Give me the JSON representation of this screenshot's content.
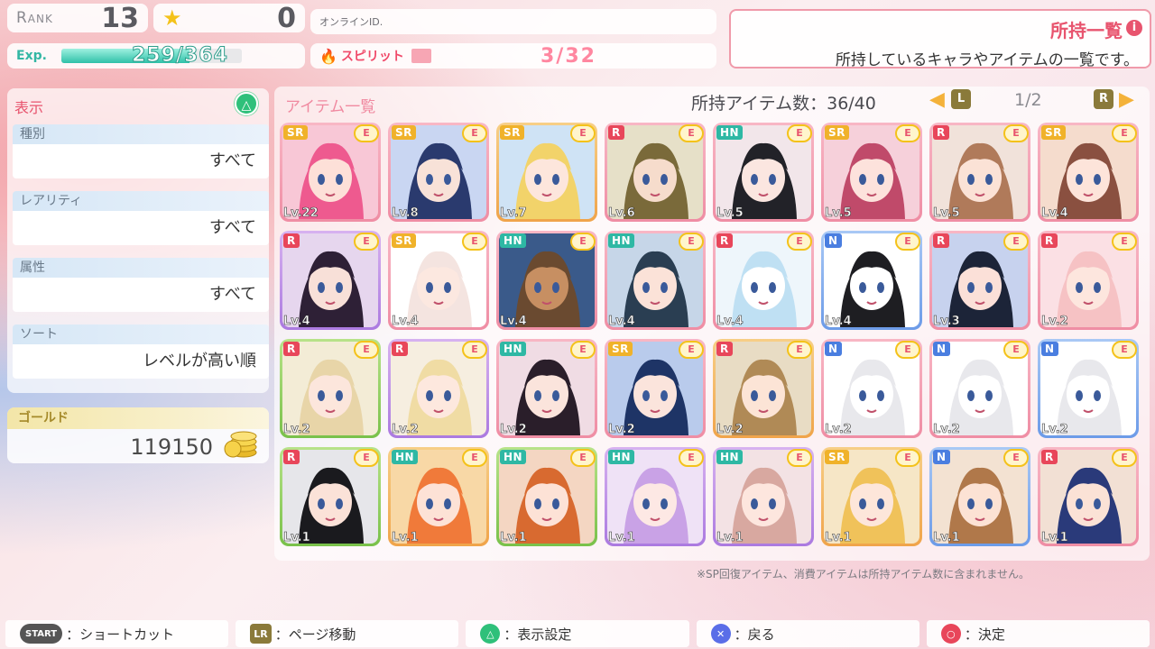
{
  "header": {
    "rank_label": "Rank",
    "rank_value": "13",
    "star_value": "0",
    "exp_label": "Exp.",
    "exp_value": "259/364",
    "exp_fraction": 0.71,
    "online_label": "オンラインID.",
    "spirit_label": "スピリット",
    "spirit_value": "3/32"
  },
  "info": {
    "title": "所持一覧",
    "description": "所持しているキャラやアイテムの一覧です。"
  },
  "filter": {
    "title": "表示",
    "rows": [
      {
        "label": "種別",
        "value": "すべて"
      },
      {
        "label": "レアリティ",
        "value": "すべて"
      },
      {
        "label": "属性",
        "value": "すべて"
      },
      {
        "label": "ソート",
        "value": "レベルが高い順"
      }
    ],
    "gold_label": "ゴールド",
    "gold_value": "119150"
  },
  "items": {
    "title": "アイテム一覧",
    "count_label": "所持アイテム数：36/40",
    "l_label": "L",
    "r_label": "R",
    "page": "1/2",
    "equip_label": "E",
    "cards": [
      {
        "rarity": "SR",
        "level": "Lv.22",
        "frame": "pink",
        "hair": "#ee5a8f",
        "skin": "#fde0d8",
        "bg": "#f8c7d6"
      },
      {
        "rarity": "SR",
        "level": "Lv.8",
        "frame": "pink",
        "hair": "#2a3a6e",
        "skin": "#f8e2d8",
        "bg": "#c9d6f2"
      },
      {
        "rarity": "SR",
        "level": "Lv.7",
        "frame": "orange",
        "hair": "#f2d36a",
        "skin": "#fde6dc",
        "bg": "#cfe3f5"
      },
      {
        "rarity": "R",
        "level": "Lv.6",
        "frame": "pink",
        "hair": "#7a6a3a",
        "skin": "#f6dccc",
        "bg": "#e6e0c8"
      },
      {
        "rarity": "HN",
        "level": "Lv.5",
        "frame": "pink",
        "hair": "#222228",
        "skin": "#fbe6e0",
        "bg": "#f2e6ea"
      },
      {
        "rarity": "SR",
        "level": "Lv.5",
        "frame": "pink",
        "hair": "#c04a6a",
        "skin": "#fde2dc",
        "bg": "#f6d0da"
      },
      {
        "rarity": "R",
        "level": "Lv.5",
        "frame": "pink",
        "hair": "#b07a5a",
        "skin": "#fbe2d6",
        "bg": "#f1e2da"
      },
      {
        "rarity": "SR",
        "level": "Lv.4",
        "frame": "pink",
        "hair": "#8a5040",
        "skin": "#fde4da",
        "bg": "#f5dccd"
      },
      {
        "rarity": "R",
        "level": "Lv.4",
        "frame": "purple",
        "hair": "#2e2036",
        "skin": "#f8e0d8",
        "bg": "#e6d6ee"
      },
      {
        "rarity": "SR",
        "level": "Lv.4",
        "frame": "pink",
        "hair": "#f4e4e0",
        "skin": "#fce8e0",
        "bg": "#ffffff"
      },
      {
        "rarity": "HN",
        "level": "Lv.4",
        "frame": "pink",
        "hair": "#6a4a30",
        "skin": "#c78f62",
        "bg": "#3a5a8a"
      },
      {
        "rarity": "HN",
        "level": "Lv.4",
        "frame": "pink",
        "hair": "#2a3e52",
        "skin": "#fbe2d8",
        "bg": "#c6d6e8"
      },
      {
        "rarity": "R",
        "level": "Lv.4",
        "frame": "pink",
        "hair": "#bfe0f3",
        "skin": "#ffffff",
        "bg": "#eef6fb"
      },
      {
        "rarity": "N",
        "level": "Lv.4",
        "frame": "blue",
        "hair": "#1e1e22",
        "skin": "#ffffff",
        "bg": "#ffffff"
      },
      {
        "rarity": "R",
        "level": "Lv.3",
        "frame": "pink",
        "hair": "#1c2438",
        "skin": "#fbe0d8",
        "bg": "#c7d2ee"
      },
      {
        "rarity": "R",
        "level": "Lv.2",
        "frame": "pink",
        "hair": "#f6c2c4",
        "skin": "#fde6de",
        "bg": "#fbe0e4"
      },
      {
        "rarity": "R",
        "level": "Lv.2",
        "frame": "green",
        "hair": "#e8d5a8",
        "skin": "#fce6dc",
        "bg": "#f3ecd6"
      },
      {
        "rarity": "R",
        "level": "Lv.2",
        "frame": "purple",
        "hair": "#f0dca4",
        "skin": "#fde8de",
        "bg": "#f6eee0"
      },
      {
        "rarity": "HN",
        "level": "Lv.2",
        "frame": "pink",
        "hair": "#2a1e2a",
        "skin": "#fbe4dc",
        "bg": "#f0dce4"
      },
      {
        "rarity": "SR",
        "level": "Lv.2",
        "frame": "pink",
        "hair": "#1e3466",
        "skin": "#fbe4dc",
        "bg": "#b9cbec"
      },
      {
        "rarity": "R",
        "level": "Lv.2",
        "frame": "orange",
        "hair": "#b08a56",
        "skin": "#fce4d6",
        "bg": "#e8dcc4"
      },
      {
        "rarity": "N",
        "level": "Lv.2",
        "frame": "pink",
        "hair": "#e8e8ec",
        "skin": "#ffffff",
        "bg": "#ffffff"
      },
      {
        "rarity": "N",
        "level": "Lv.2",
        "frame": "pink",
        "hair": "#e8e8ec",
        "skin": "#ffffff",
        "bg": "#ffffff"
      },
      {
        "rarity": "N",
        "level": "Lv.2",
        "frame": "blue",
        "hair": "#e8e8ec",
        "skin": "#ffffff",
        "bg": "#ffffff"
      },
      {
        "rarity": "R",
        "level": "Lv.1",
        "frame": "green",
        "hair": "#1a1a1e",
        "skin": "#fbe2d8",
        "bg": "#e6e6ea"
      },
      {
        "rarity": "HN",
        "level": "Lv.1",
        "frame": "orange",
        "hair": "#f07a3a",
        "skin": "#fde2d6",
        "bg": "#f8d8a6"
      },
      {
        "rarity": "HN",
        "level": "Lv.1",
        "frame": "green",
        "hair": "#d86a30",
        "skin": "#fde2d6",
        "bg": "#f4d6c2"
      },
      {
        "rarity": "HN",
        "level": "Lv.1",
        "frame": "purple",
        "hair": "#c9a2e6",
        "skin": "#fde8e4",
        "bg": "#efe2f6"
      },
      {
        "rarity": "HN",
        "level": "Lv.1",
        "frame": "purple",
        "hair": "#d8a8a0",
        "skin": "#fde6de",
        "bg": "#f3e2e4"
      },
      {
        "rarity": "SR",
        "level": "Lv.1",
        "frame": "orange",
        "hair": "#f0c25a",
        "skin": "#fde6da",
        "bg": "#f6e6c6"
      },
      {
        "rarity": "N",
        "level": "Lv.1",
        "frame": "blue",
        "hair": "#b0784a",
        "skin": "#fce2d4",
        "bg": "#f3e2d2"
      },
      {
        "rarity": "R",
        "level": "Lv.1",
        "frame": "pink",
        "hair": "#2a3a7a",
        "skin": "#fbe2d6",
        "bg": "#f2e0d4"
      }
    ]
  },
  "note": "※SP回復アイテム、消費アイテムは所持アイテム数に含まれません。",
  "bottom": {
    "start_icon": "START",
    "start_label": "：ショートカット",
    "lr_icon": "LR",
    "lr_label": "：ページ移動",
    "tri_icon": "△",
    "tri_label": "：表示設定",
    "cross_icon": "✕",
    "cross_label": "：戻る",
    "circle_icon": "○",
    "circle_label": "：決定"
  }
}
